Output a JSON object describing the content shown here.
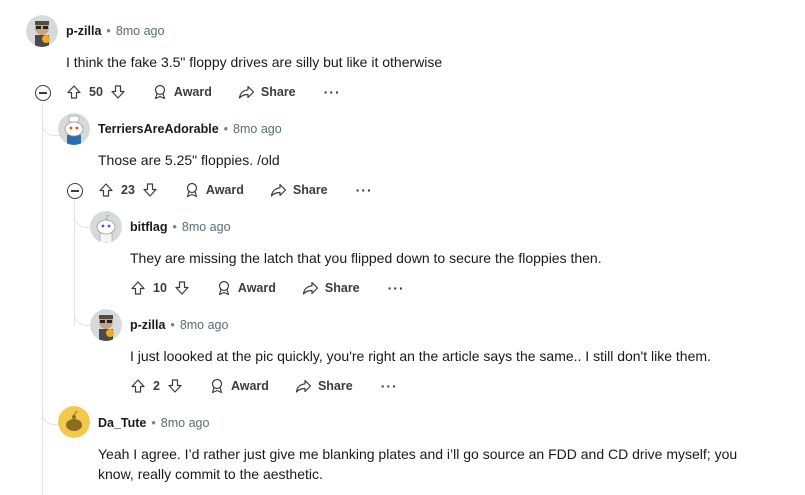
{
  "comments": [
    {
      "username": "p-zilla",
      "separator": "•",
      "time": "8mo ago",
      "text": "I think the fake 3.5\" floppy drives are silly but like it otherwise",
      "votes": "50",
      "award_label": "Award",
      "share_label": "Share",
      "more_label": "···"
    },
    {
      "username": "TerriersAreAdorable",
      "separator": "•",
      "time": "8mo ago",
      "text": "Those are 5.25\" floppies. /old",
      "votes": "23",
      "award_label": "Award",
      "share_label": "Share",
      "more_label": "···"
    },
    {
      "username": "bitflag",
      "separator": "•",
      "time": "8mo ago",
      "text": "They are missing the latch that you flipped down to secure the floppies then.",
      "votes": "10",
      "award_label": "Award",
      "share_label": "Share",
      "more_label": "···"
    },
    {
      "username": "p-zilla",
      "separator": "•",
      "time": "8mo ago",
      "text": "I just loooked at the pic quickly, you're right an the article says the same.. I still don't like them.",
      "votes": "2",
      "award_label": "Award",
      "share_label": "Share",
      "more_label": "···"
    },
    {
      "username": "Da_Tute",
      "separator": "•",
      "time": "8mo ago",
      "text": "Yeah I agree. I’d rather just give me blanking plates and i’ll go source an FDD and CD drive myself; you know, really commit to the aesthetic."
    }
  ],
  "colors": {
    "text": "#1a1a1b",
    "meta": "#576f76",
    "thread_line": "#e0e4e7",
    "icon": "#3c3c3c"
  }
}
